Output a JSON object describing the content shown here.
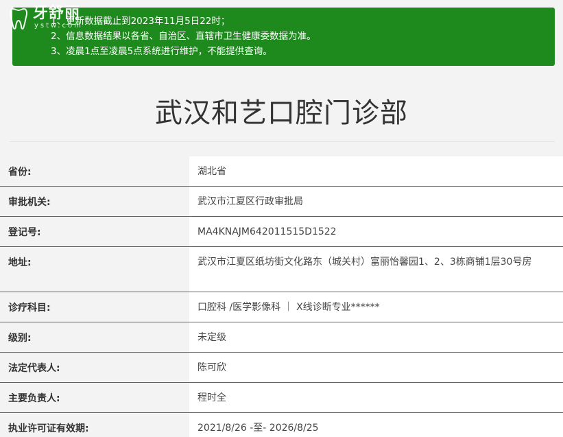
{
  "watermark": {
    "title": "牙舒丽",
    "subtitle": "ystw.com"
  },
  "notice": {
    "lines": [
      "1、更新数据截止到2023年11月5日22时；",
      "2、信息数据结果以各省、自治区、直辖市卫生健康委数据为准。",
      "3、凌晨1点至凌晨5点系统进行维护，不能提供查询。"
    ]
  },
  "clinic": {
    "name": "武汉和艺口腔门诊部"
  },
  "details": [
    {
      "label": "省份:",
      "value": "湖北省"
    },
    {
      "label": "审批机关:",
      "value": "武汉市江夏区行政审批局"
    },
    {
      "label": "登记号:",
      "value": "MA4KNAJM642011515D1522"
    },
    {
      "label": "地址:",
      "value": "武汉市江夏区纸坊街文化路东（城关村）富丽怡馨园1、2、3栋商铺1层30号房"
    },
    {
      "label": "诊疗科目:",
      "value": "口腔科 /医学影像科 ｜ X线诊断专业******"
    },
    {
      "label": "级别:",
      "value": "未定级"
    },
    {
      "label": "法定代表人:",
      "value": "陈可欣"
    },
    {
      "label": "主要负责人:",
      "value": "程时全"
    },
    {
      "label": "执业许可证有效期:",
      "value": "2021/8/26 -至- 2026/8/25"
    }
  ],
  "colors": {
    "notice_bg": "#1e8a1e",
    "row_divider": "#2e7d4a",
    "page_bg": "#f3f3f3"
  }
}
